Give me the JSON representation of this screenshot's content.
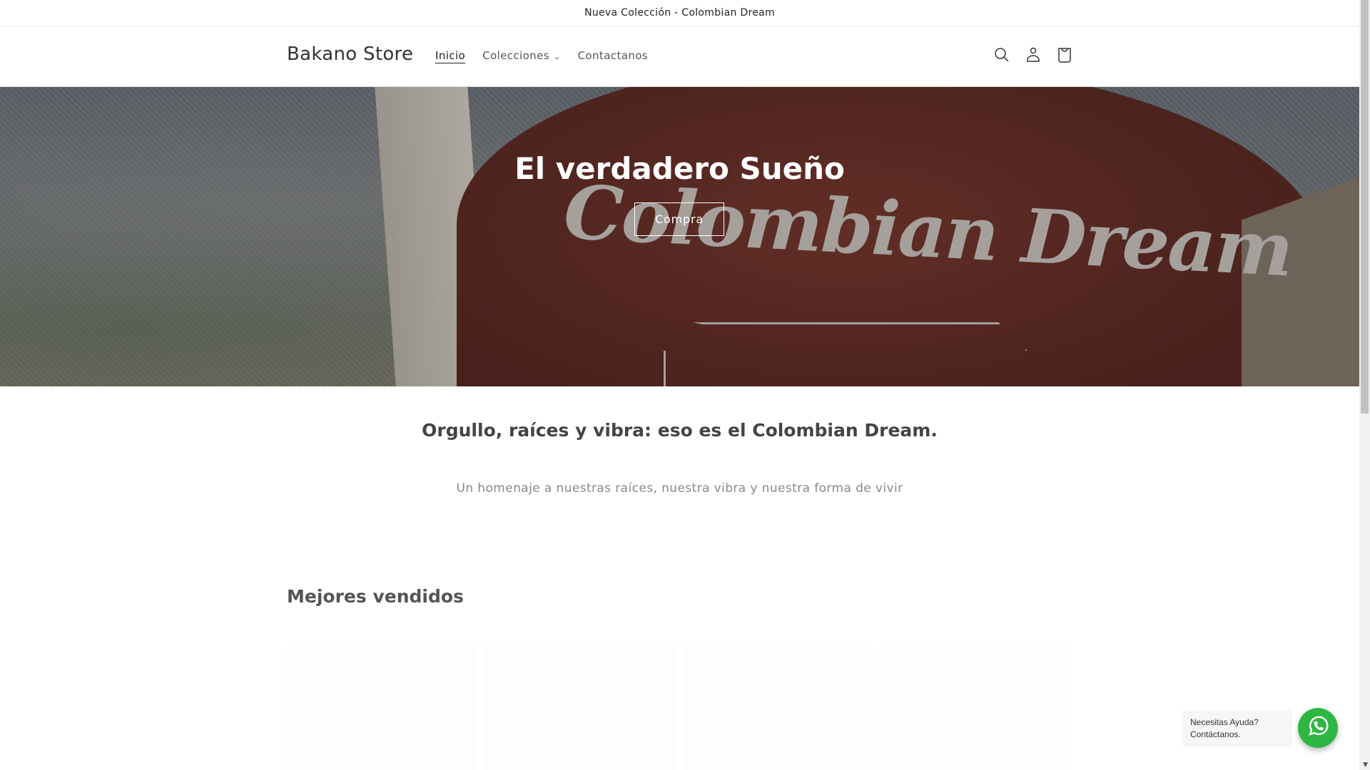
{
  "announcement": "Nueva Colección - Colombian Dream",
  "header": {
    "logo": "Bakano Store",
    "nav": [
      {
        "label": "Inicio"
      },
      {
        "label": "Colecciones"
      },
      {
        "label": "Contactanos"
      }
    ]
  },
  "icons": {
    "search": "search-icon",
    "account": "user-icon",
    "cart": "cart-icon"
  },
  "hero": {
    "title": "El verdadero Sueño",
    "button": "Compra",
    "print_lettering": "Colombian Dream"
  },
  "intro": {
    "heading": "Orgullo, raíces y vibra: eso es el Colombian Dream.",
    "text": "Un homenaje a nuestras raíces, nuestra vibra y nuestra forma de vivir"
  },
  "featured": {
    "heading": "Mejores vendidos"
  },
  "whatsapp": {
    "line1": "Necesitas Ayuda?",
    "line2": "Contáctanos.",
    "color": "#2db742"
  }
}
